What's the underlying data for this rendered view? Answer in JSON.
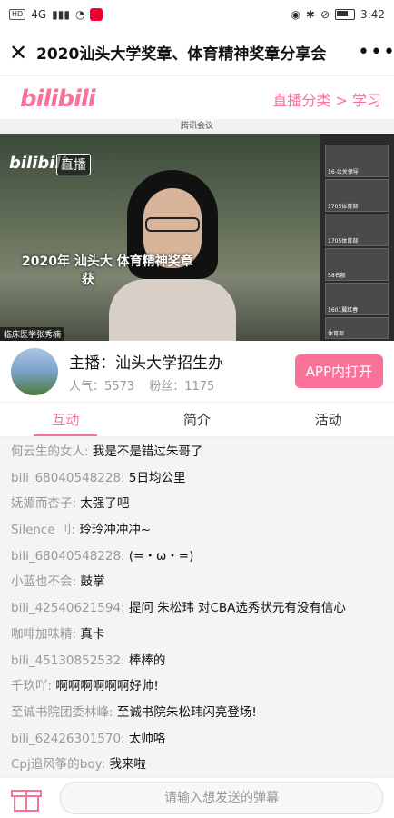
{
  "status_bar": {
    "time": "3:42",
    "left_badge": "HD",
    "network": "4G"
  },
  "header": {
    "title": "2020汕头大学奖章、体育精神奖章分享会",
    "close_icon": "close-icon",
    "more_icon": "more-icon"
  },
  "brand": {
    "logo": "bilibili",
    "breadcrumb": "直播分类 > 学习"
  },
  "video": {
    "window_title": "腾讯会议",
    "live_logo": "bilibili",
    "live_tag": "直播",
    "overlay_line1": "2020年 汕头大      体育精神奖章",
    "overlay_line2": "获",
    "speaker_tag": "临床医学张秀楠",
    "thumbs": [
      "16-公关领导",
      "1705体育部",
      "1705体育部",
      "58名额",
      "1601翼红春",
      "体育部"
    ]
  },
  "host": {
    "name": "主播：汕头大学招生办",
    "popularity": "人气：5573",
    "fans": "粉丝：1175",
    "open_button": "APP内打开"
  },
  "tabs": [
    {
      "label": "互动",
      "active": true
    },
    {
      "label": "简介",
      "active": false
    },
    {
      "label": "活动",
      "active": false
    }
  ],
  "messages": [
    {
      "user": "何云生的女人:",
      "text": "我是不是错过朱哥了"
    },
    {
      "user": "bili_68040548228:",
      "text": "5日均公里"
    },
    {
      "user": "妩媚而杏子:",
      "text": "太强了吧"
    },
    {
      "user": "Silence 刂:",
      "text": "玲玲冲冲冲~"
    },
    {
      "user": "bili_68040548228:",
      "text": "(=・ω・=)"
    },
    {
      "user": "小蓝也不会:",
      "text": "鼓掌"
    },
    {
      "user": "bili_42540621594:",
      "text": "提问 朱松玮 对CBA选秀状元有没有信心"
    },
    {
      "user": "咖啡加味精:",
      "text": "真卡"
    },
    {
      "user": "bili_45130852532:",
      "text": "棒棒的"
    },
    {
      "user": "千玖吖:",
      "text": "啊啊啊啊啊啊好帅!"
    },
    {
      "user": "至诚书院团委林峰:",
      "text": "至诚书院朱松玮闪亮登场!"
    },
    {
      "user": "bili_62426301570:",
      "text": "太帅咯"
    },
    {
      "user": "Cpj追风筝的boy:",
      "text": "我来啦"
    }
  ],
  "input": {
    "placeholder": "请输入想发送的弹幕"
  },
  "colors": {
    "accent": "#fb7299"
  }
}
